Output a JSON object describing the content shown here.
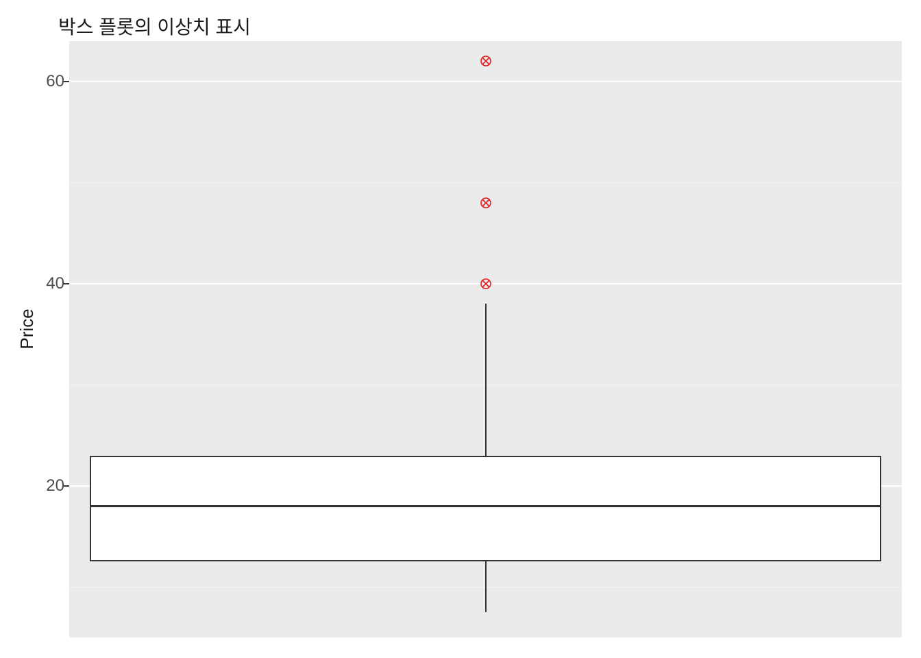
{
  "chart_data": {
    "type": "boxplot",
    "title": "박스 플롯의 이상치 표시",
    "ylabel": "Price",
    "xlabel": "",
    "ylim": [
      5,
      64
    ],
    "y_ticks": [
      20,
      40,
      60
    ],
    "box": {
      "lower_whisker": 7.5,
      "q1": 12.5,
      "median": 18,
      "q3": 23,
      "upper_whisker": 38
    },
    "outliers": [
      40,
      48,
      62
    ],
    "outlier_style": {
      "shape": "circle-x",
      "color": "#e41a1c"
    },
    "colors": {
      "panel_bg": "#ebebeb",
      "grid": "#ffffff",
      "box_fill": "#ffffff",
      "box_stroke": "#333333"
    }
  }
}
